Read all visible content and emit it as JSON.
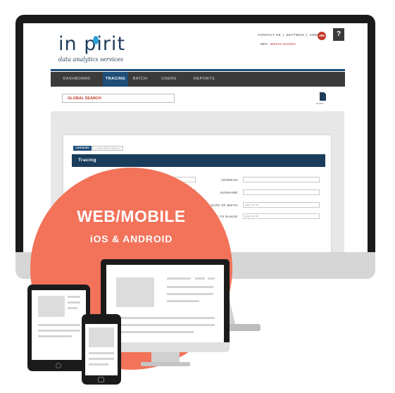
{
  "site": {
    "logo_text": "in  pirit",
    "tagline": "data analytics services",
    "top_links": [
      "CONTACT US",
      "|",
      "SETTINGS",
      "|",
      "CREDITS"
    ],
    "credits_count": "456",
    "greeting": "HEY!",
    "user_name": "MISCHA NAIDOO",
    "help_label": "?"
  },
  "nav": {
    "items": [
      "DASHBOARD",
      "TRACING",
      "BATCH",
      "USERS",
      "REPORTS"
    ],
    "active": "TRACING"
  },
  "search": {
    "label": "GLOBAL SEARCH"
  },
  "doc_icon_label": "NOTIFY",
  "form": {
    "tabs": [
      "CATEGORY",
      "CONSUMER SEARCH"
    ],
    "title": "Tracing",
    "fields": [
      {
        "label": "ADDRESS:",
        "value": ""
      },
      {
        "label": "SURNAME:",
        "value": ""
      },
      {
        "label": "DATE OF BIRTH:",
        "value": "yyyy mm dd"
      },
      {
        "label": "DOB TO RANGE:",
        "value": "yyyy mm dd"
      }
    ]
  },
  "badge": {
    "title": "WEB/MOBILE",
    "subtitle": "iOS & ANDROID"
  },
  "colors": {
    "accent": "#1f4e79",
    "badge": "#f2725a",
    "alert": "#c0392b"
  }
}
